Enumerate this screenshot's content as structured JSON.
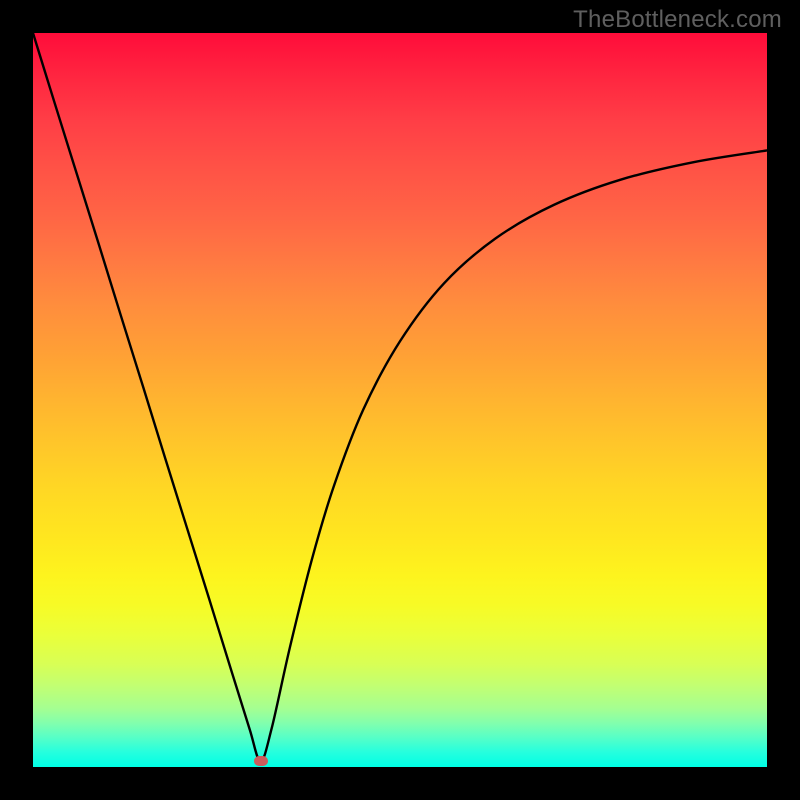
{
  "watermark": "TheBottleneck.com",
  "marker": {
    "x_frac": 0.31,
    "y_frac": 0.992
  },
  "chart_data": {
    "type": "line",
    "title": "",
    "xlabel": "",
    "ylabel": "",
    "xlim": [
      0,
      1
    ],
    "ylim": [
      0,
      1
    ],
    "legend": false,
    "grid": false,
    "background": "rainbow-vertical",
    "annotations": [
      "TheBottleneck.com"
    ],
    "series": [
      {
        "name": "bottleneck-curve",
        "color": "#000000",
        "x": [
          0.0,
          0.03,
          0.06,
          0.09,
          0.12,
          0.15,
          0.18,
          0.21,
          0.24,
          0.27,
          0.295,
          0.31,
          0.325,
          0.35,
          0.38,
          0.41,
          0.45,
          0.5,
          0.56,
          0.63,
          0.71,
          0.8,
          0.9,
          1.0
        ],
        "y": [
          1.0,
          0.903,
          0.807,
          0.711,
          0.614,
          0.518,
          0.421,
          0.325,
          0.229,
          0.132,
          0.052,
          0.008,
          0.052,
          0.163,
          0.283,
          0.383,
          0.487,
          0.58,
          0.659,
          0.72,
          0.766,
          0.8,
          0.824,
          0.84
        ],
        "note": "y measured as fraction of plot height from bottom; x as fraction from left. Curve touches ~0 near x≈0.31 (marker position)."
      }
    ]
  }
}
